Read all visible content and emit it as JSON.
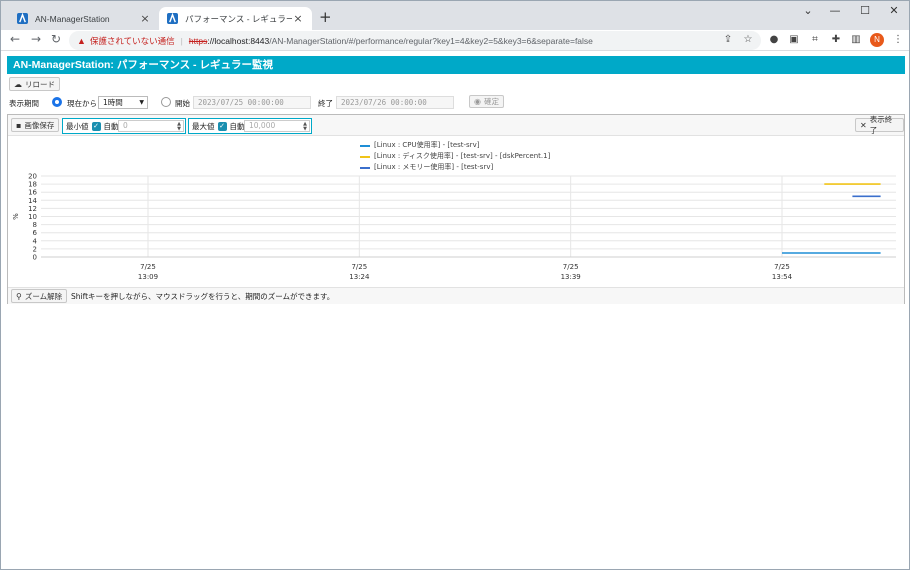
{
  "browser": {
    "tabs": [
      {
        "title": "AN-ManagerStation",
        "active": false
      },
      {
        "title": "パフォーマンス - レギュラー監視",
        "active": true
      }
    ],
    "address": {
      "warning": "保護されていない通信",
      "scheme": "https",
      "host": "://localhost:8443",
      "path": "/AN-ManagerStation/#/performance/regular?key1=4&key2=5&key3=6&separate=false"
    },
    "profile_initial": "N"
  },
  "app": {
    "title": "AN-ManagerStation: パフォーマンス - レギュラー監視",
    "reload_label": "リロード",
    "period": {
      "label": "表示期間",
      "from_now_label": "現在から",
      "range_value": "1時間",
      "start_label": "開始",
      "start_value": "2023/07/25 00:00:00",
      "end_label": "終了",
      "end_value": "2023/07/26 00:00:00",
      "confirm_label": "確定"
    },
    "controls": {
      "save_image_label": "画像保存",
      "min_label": "最小値",
      "min_auto_label": "自動",
      "min_value": "0",
      "max_label": "最大値",
      "max_auto_label": "自動",
      "max_value": "10,000",
      "end_view_label": "表示終了"
    },
    "footer": {
      "zoom_reset_label": "ズーム解除",
      "hint": "Shiftキーを押しながら、マウスドラッグを行うと、期間のズームができます。"
    }
  },
  "chart_data": {
    "type": "line",
    "ylabel": "%",
    "ylim": [
      0,
      20
    ],
    "yticks": [
      0,
      2,
      4,
      6,
      8,
      10,
      12,
      14,
      16,
      18,
      20
    ],
    "xticks": [
      {
        "date": "7/25",
        "time": "13:09"
      },
      {
        "date": "7/25",
        "time": "13:24"
      },
      {
        "date": "7/25",
        "time": "13:39"
      },
      {
        "date": "7/25",
        "time": "13:54"
      }
    ],
    "series": [
      {
        "name": "[Linux : CPU使用率] - [test-srv]",
        "color": "#1e8ed6",
        "x": [
          "13:54",
          "13:61"
        ],
        "y": [
          1,
          1
        ]
      },
      {
        "name": "[Linux : ディスク使用率] - [test-srv] - [dskPercent.1]",
        "color": "#f0c419",
        "x": [
          "13:57",
          "13:61"
        ],
        "y": [
          18,
          18
        ]
      },
      {
        "name": "[Linux : メモリー使用率] - [test-srv]",
        "color": "#3b6fcc",
        "x": [
          "13:59",
          "13:61"
        ],
        "y": [
          15,
          15
        ]
      }
    ]
  },
  "colors": {
    "accent": "#00a9c8",
    "warning": "#c5221f"
  },
  "icons": {
    "cloud": "cloud-icon",
    "save": "save-icon",
    "close": "close-icon",
    "zoom": "zoom-icon"
  }
}
